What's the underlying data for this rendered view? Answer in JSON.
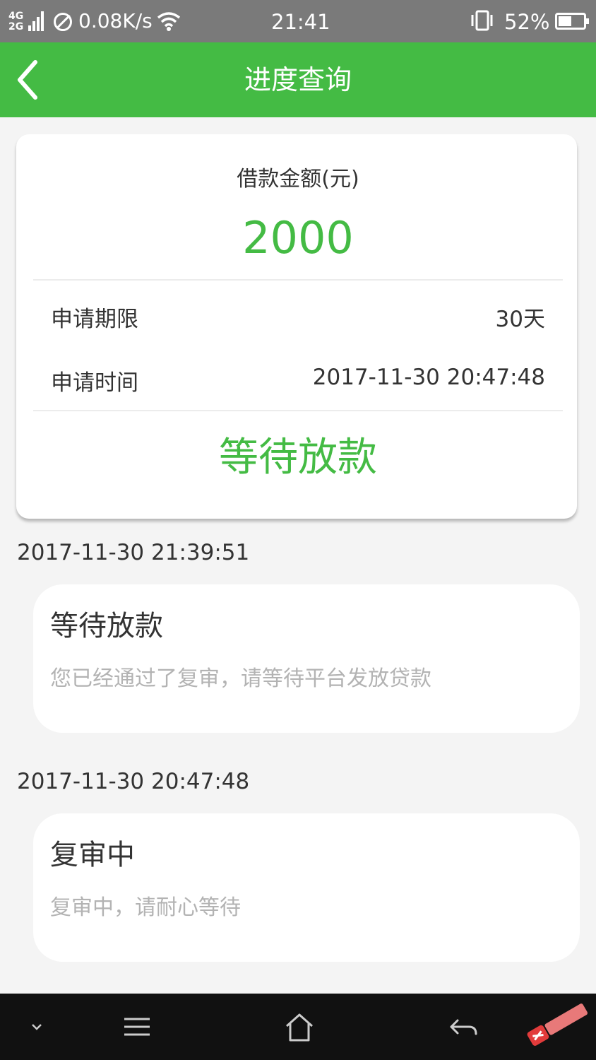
{
  "status_bar": {
    "net_top": "4G",
    "net_bottom": "2G",
    "speed": "0.08K/s",
    "time": "21:41",
    "battery": "52%",
    "battery_level": 0.52
  },
  "header": {
    "title": "进度查询"
  },
  "summary": {
    "amount_label": "借款金额(元)",
    "amount_value": "2000",
    "term_label": "申请期限",
    "term_value": "30天",
    "time_label": "申请时间",
    "time_value": "2017-11-30 20:47:48",
    "status": "等待放款"
  },
  "timeline": [
    {
      "time": "2017-11-30 21:39:51",
      "title": "等待放款",
      "desc": "您已经通过了复审，请等待平台发放贷款"
    },
    {
      "time": "2017-11-30 20:47:48",
      "title": "复审中",
      "desc": "复审中，请耐心等待"
    }
  ],
  "colors": {
    "accent": "#44bb44",
    "status_bar": "#7a7a7a",
    "background": "#f4f4f4"
  },
  "icons": {
    "back": "chevron-left-icon",
    "menu": "menu-icon",
    "home": "home-icon",
    "return": "return-arrow-icon"
  }
}
